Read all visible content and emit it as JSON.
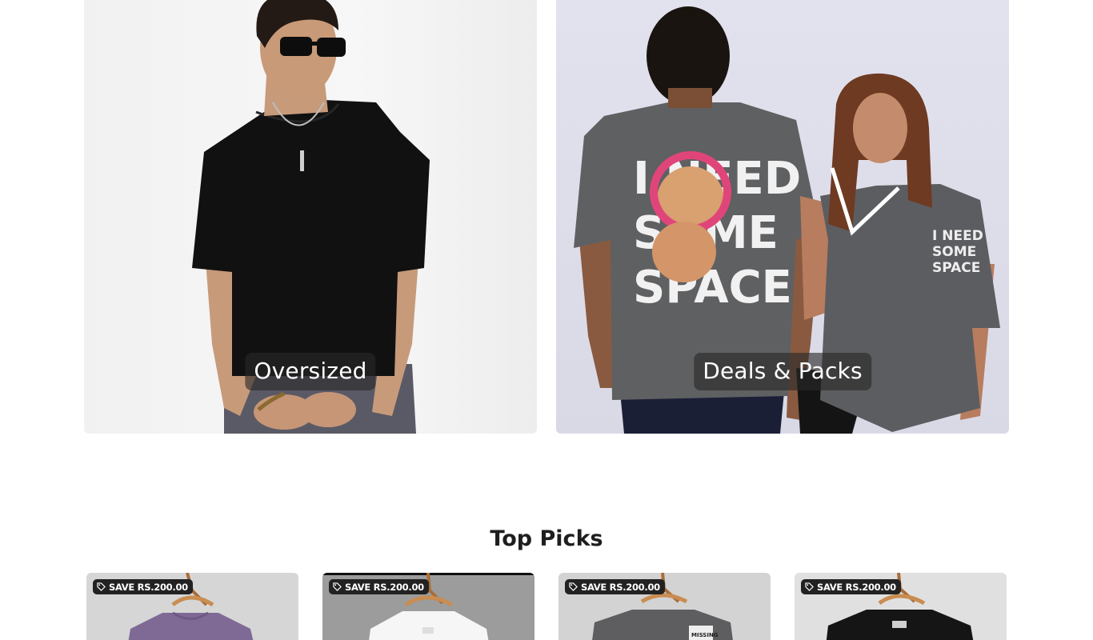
{
  "collections": [
    {
      "label": "Oversized",
      "icon": "black-tee-model-photo"
    },
    {
      "label": "Deals & Packs",
      "icon": "couple-grey-tees-photo",
      "print_lines": [
        "I NEED",
        "SOME",
        "SPACE"
      ]
    }
  ],
  "top_picks": {
    "title": "Top Picks",
    "products": [
      {
        "badge": "SAVE RS.200.00",
        "tee_color": "#7f6a96"
      },
      {
        "badge": "SAVE RS.200.00",
        "tee_color": "#f6f6f6"
      },
      {
        "badge": "SAVE RS.200.00",
        "tee_color": "#5e5e60",
        "print": "MISSING"
      },
      {
        "badge": "SAVE RS.200.00",
        "tee_color": "#151515"
      }
    ]
  },
  "colors": {
    "badge_bg": "#222222",
    "label_overlay": "rgba(40,40,40,0.62)",
    "title": "#1e1e1e"
  }
}
